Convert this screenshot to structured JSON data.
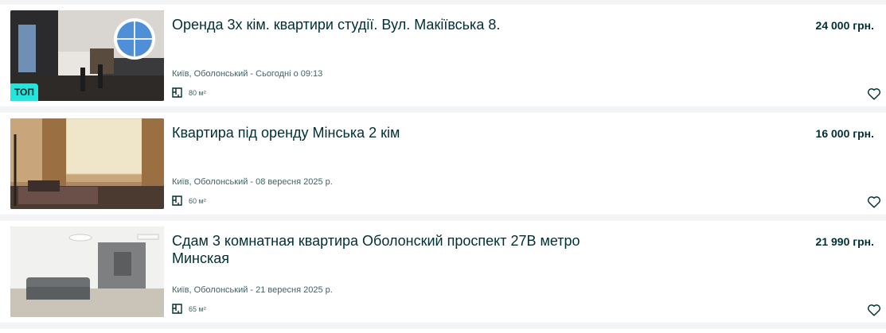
{
  "listings": [
    {
      "title": "Оренда 3х кім. квартири студії. Вул. Макіївська 8.",
      "price": "24 000 грн.",
      "location_date": "Київ, Оболонський - Сьогодні о 09:13",
      "area": "80 м²",
      "badge": "ТОП",
      "photo_icon": "apartment-photo",
      "favorite_icon": "heart-icon"
    },
    {
      "title": "Квартира під оренду Мінська 2 кім",
      "price": "16 000 грн.",
      "location_date": "Київ, Оболонський - 08 вересня 2025 р.",
      "area": "60 м²",
      "photo_icon": "apartment-photo",
      "favorite_icon": "heart-icon"
    },
    {
      "title": "Сдам 3 комнатная квартира Оболонский проспект 27В метро Минская",
      "price": "21 990 грн.",
      "location_date": "Київ, Оболонський - 21 вересня 2025 р.",
      "area": "65 м²",
      "photo_icon": "apartment-photo",
      "favorite_icon": "heart-icon"
    }
  ],
  "colors": {
    "accent_badge": "#23e5db",
    "text_primary": "#002f34",
    "text_secondary": "#406367",
    "page_background": "#f2f4f5"
  }
}
